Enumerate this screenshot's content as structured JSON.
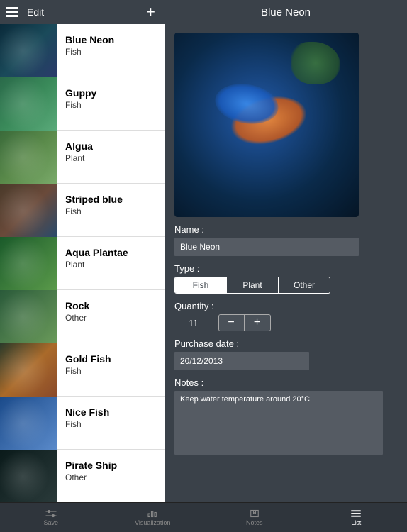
{
  "header": {
    "edit_label": "Edit",
    "add_symbol": "+",
    "title": "Blue Neon"
  },
  "sidebar": {
    "items": [
      {
        "name": "Blue Neon",
        "type": "Fish"
      },
      {
        "name": "Guppy",
        "type": "Fish"
      },
      {
        "name": "Algua",
        "type": "Plant"
      },
      {
        "name": "Striped blue",
        "type": "Fish"
      },
      {
        "name": "Aqua Plantae",
        "type": "Plant"
      },
      {
        "name": "Rock",
        "type": "Other"
      },
      {
        "name": "Gold Fish",
        "type": "Fish"
      },
      {
        "name": "Nice Fish",
        "type": "Fish"
      },
      {
        "name": "Pirate Ship",
        "type": "Other"
      }
    ]
  },
  "detail": {
    "labels": {
      "name": "Name :",
      "type": "Type :",
      "quantity": "Quantity :",
      "purchase_date": "Purchase date :",
      "notes": "Notes :"
    },
    "name_value": "Blue Neon",
    "type_options": {
      "fish": "Fish",
      "plant": "Plant",
      "other": "Other"
    },
    "type_selected": "fish",
    "quantity_value": "11",
    "stepper": {
      "minus": "−",
      "plus": "+"
    },
    "purchase_date_value": "20/12/2013",
    "notes_value": "Keep water temperature around 20°C"
  },
  "tabbar": {
    "save": "Save",
    "visualization": "Visualization",
    "notes": "Notes",
    "list": "List"
  },
  "icons": {
    "photos_stack": "photos-stack-icon",
    "camera": "camera-icon"
  }
}
